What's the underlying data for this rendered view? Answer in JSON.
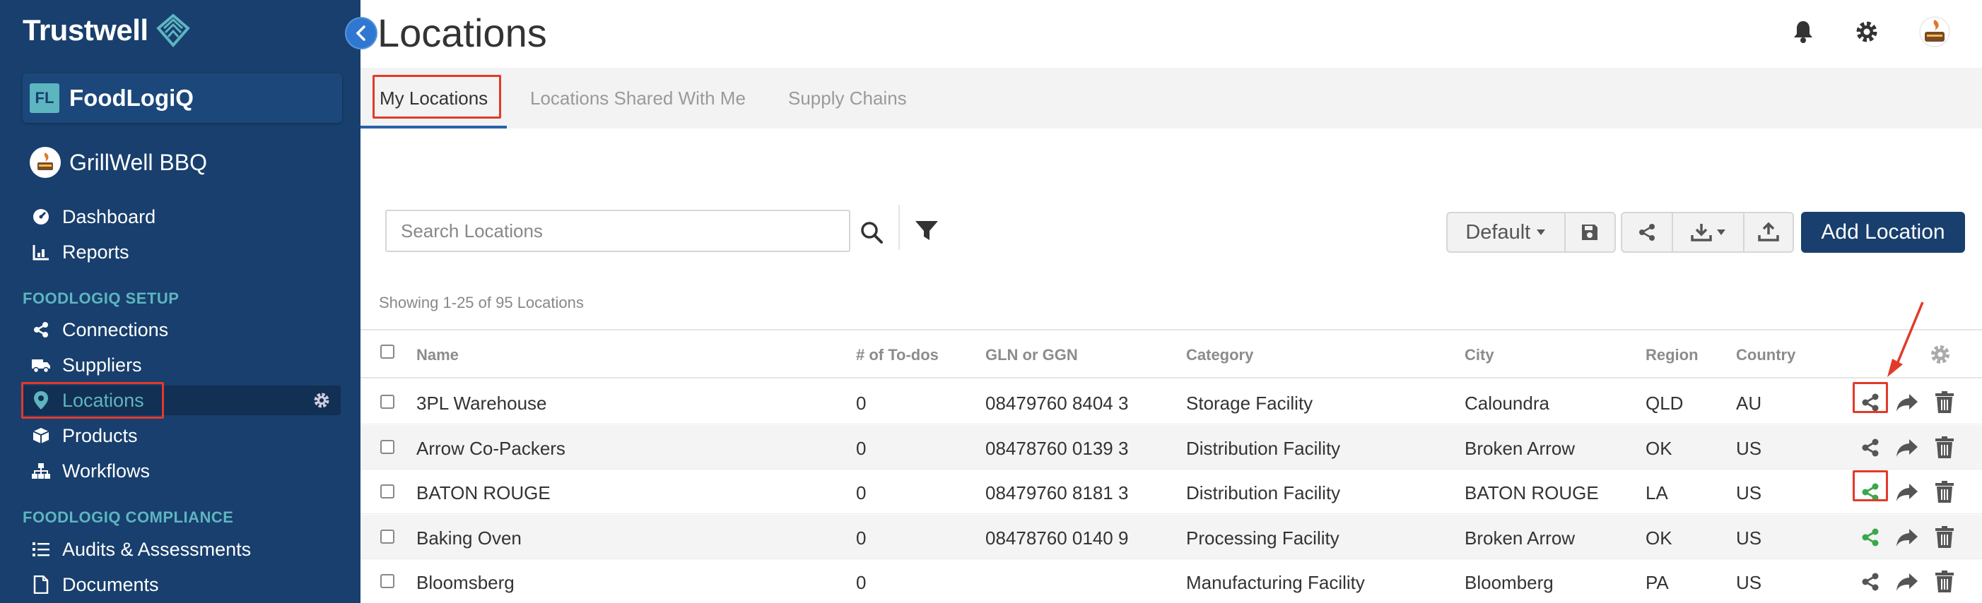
{
  "sidebar": {
    "brand": "Trustwell",
    "org_badge": "FL",
    "org_name": "FoodLogiQ",
    "company": "GrillWell BBQ",
    "nav_main": [
      {
        "label": "Dashboard",
        "icon": "dashboard-icon"
      },
      {
        "label": "Reports",
        "icon": "chart-icon"
      }
    ],
    "setup_heading": "FOODLOGIQ SETUP",
    "nav_setup": [
      {
        "label": "Connections",
        "icon": "share-icon"
      },
      {
        "label": "Suppliers",
        "icon": "truck-icon"
      },
      {
        "label": "Locations",
        "icon": "map-pin-icon",
        "active": true
      },
      {
        "label": "Products",
        "icon": "box-icon"
      },
      {
        "label": "Workflows",
        "icon": "sitemap-icon"
      }
    ],
    "compliance_heading": "FOODLOGIQ COMPLIANCE",
    "nav_compliance": [
      {
        "label": "Audits & Assessments",
        "icon": "list-icon"
      },
      {
        "label": "Documents",
        "icon": "document-icon"
      }
    ]
  },
  "header": {
    "title": "Locations"
  },
  "tabs": [
    {
      "label": "My Locations",
      "active": true
    },
    {
      "label": "Locations Shared With Me"
    },
    {
      "label": "Supply Chains"
    }
  ],
  "toolbar": {
    "search_placeholder": "Search Locations",
    "view_select": "Default",
    "add_label": "Add Location"
  },
  "summary": "Showing 1-25 of 95 Locations",
  "table": {
    "columns": [
      "Name",
      "# of To-dos",
      "GLN or GGN",
      "Category",
      "City",
      "Region",
      "Country"
    ],
    "rows": [
      {
        "name": "3PL Warehouse",
        "todos": "0",
        "gln": "08479760 8404 3",
        "category": "Storage Facility",
        "city": "Caloundra",
        "region": "QLD",
        "country": "AU",
        "shared": false
      },
      {
        "name": "Arrow Co-Packers",
        "todos": "0",
        "gln": "08478760 0139 3",
        "category": "Distribution Facility",
        "city": "Broken Arrow",
        "region": "OK",
        "country": "US",
        "shared": false
      },
      {
        "name": "BATON ROUGE",
        "todos": "0",
        "gln": "08479760 8181 3",
        "category": "Distribution Facility",
        "city": "BATON ROUGE",
        "region": "LA",
        "country": "US",
        "shared": true
      },
      {
        "name": "Baking Oven",
        "todos": "0",
        "gln": "08478760 0140 9",
        "category": "Processing Facility",
        "city": "Broken Arrow",
        "region": "OK",
        "country": "US",
        "shared": true
      },
      {
        "name": "Bloomsberg",
        "todos": "0",
        "gln": "",
        "category": "Manufacturing Facility",
        "city": "Bloomberg",
        "region": "PA",
        "country": "US",
        "shared": false
      }
    ]
  },
  "colors": {
    "sidebar": "#183f6d",
    "accent_teal": "#5db5c0",
    "highlight_red": "#e23a2a",
    "shared_green": "#3aa84a",
    "icon_gray": "#555555"
  }
}
